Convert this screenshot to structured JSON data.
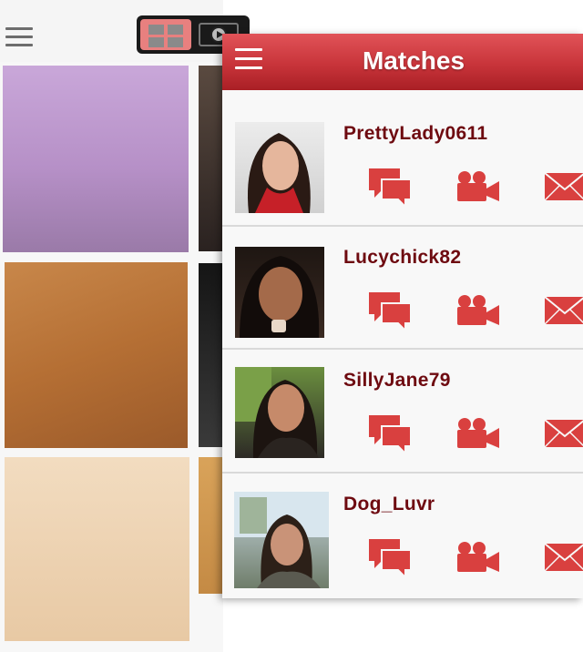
{
  "header": {
    "title": "Matches"
  },
  "matches": [
    {
      "username": "PrettyLady0611"
    },
    {
      "username": "Lucychick82"
    },
    {
      "username": "SillyJane79"
    },
    {
      "username": "Dog_Luvr"
    }
  ],
  "icons": {
    "menu": "hamburger-menu-icon",
    "grid_view": "grid-view-icon",
    "video_view": "play-icon",
    "chat": "chat-bubbles-icon",
    "video_call": "video-camera-icon",
    "mail": "envelope-icon"
  },
  "colors": {
    "header_red": "#c8343a",
    "action_red": "#d9403f",
    "username": "#6e0a10",
    "grid_toggle_active": "#e8807f"
  }
}
